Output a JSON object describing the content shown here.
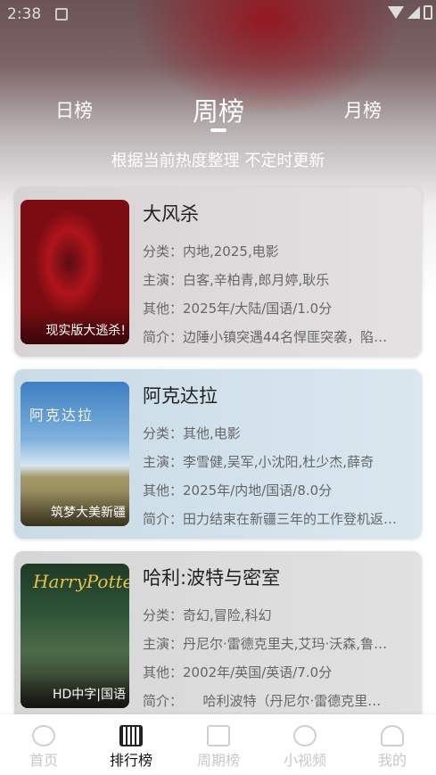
{
  "status": {
    "time": "2:38"
  },
  "tabs": [
    {
      "label": "日榜"
    },
    {
      "label": "周榜"
    },
    {
      "label": "月榜"
    }
  ],
  "subtitle": "根据当前热度整理 不定时更新",
  "movies": [
    {
      "title": "大风杀",
      "badge": "现实版大逃杀!",
      "category": "分类：内地,2025,电影",
      "cast": "主演：白客,辛柏青,郎月婷,耿乐",
      "other": "其他：2025年/大陆/国语/1.0分",
      "intro": "简介：边陲小镇突遇44名悍匪突袭，陷…"
    },
    {
      "title": "阿克达拉",
      "badge": "筑梦大美新疆",
      "poster_art": "阿克达拉",
      "category": "分类：其他,电影",
      "cast": "主演：李雪健,吴军,小沈阳,杜少杰,薛奇",
      "other": "其他：2025年/内地/国语/8.0分",
      "intro": "简介：田力结束在新疆三年的工作登机返…"
    },
    {
      "title": "哈利:波特与密室",
      "badge": "HD中字|国语",
      "poster_art": "HarryPotter",
      "category": "分类：奇幻,冒险,科幻",
      "cast": "主演：丹尼尔·雷德克里夫,艾玛·沃森,鲁…",
      "other": "其他：2002年/英国/英语/7.0分",
      "intro": "简介：　　哈利波特（丹尼尔·雷德克里…"
    }
  ],
  "bottom_nav": [
    {
      "label": "首页",
      "icon": "home-icon"
    },
    {
      "label": "排行榜",
      "icon": "ranking-icon"
    },
    {
      "label": "周期榜",
      "icon": "calendar-icon"
    },
    {
      "label": "小视频",
      "icon": "video-icon"
    },
    {
      "label": "我的",
      "icon": "profile-icon"
    }
  ],
  "colors": {
    "active_nav": "#111111",
    "inactive_nav": "#c8c8c8",
    "tab_text": "#ffffff"
  }
}
